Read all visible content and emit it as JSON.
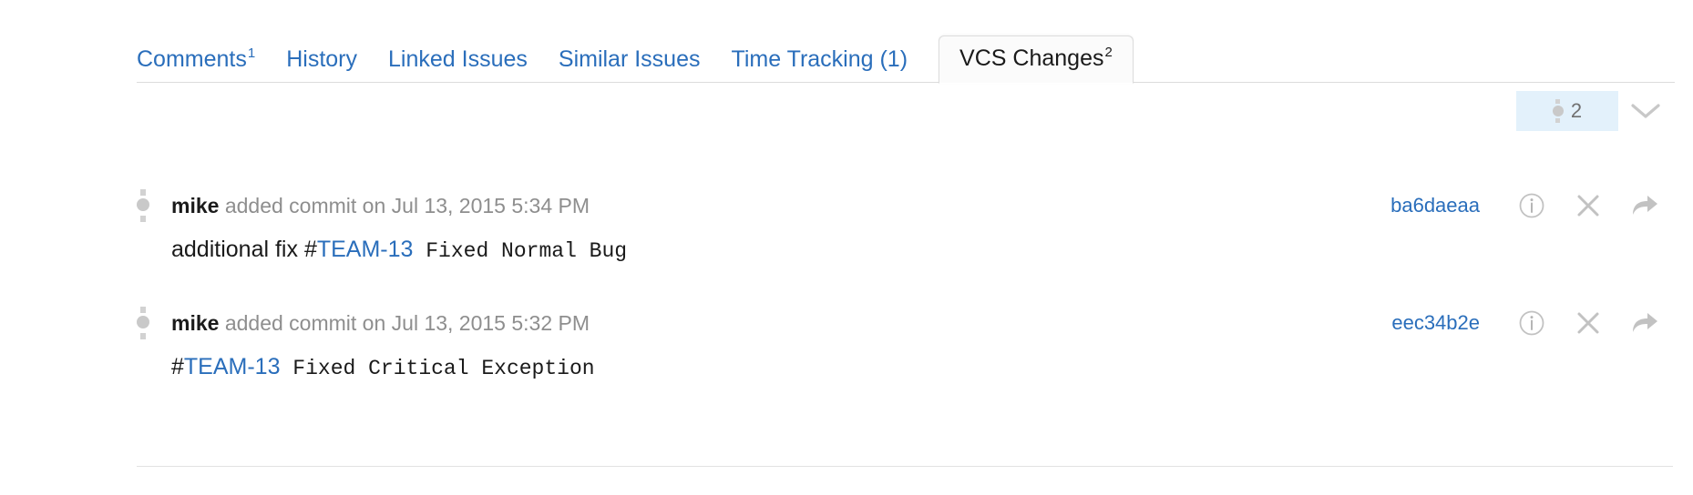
{
  "tabs": [
    {
      "label": "Comments",
      "sup": "1",
      "active": false
    },
    {
      "label": "History",
      "sup": "",
      "active": false
    },
    {
      "label": "Linked Issues",
      "sup": "",
      "active": false
    },
    {
      "label": "Similar Issues",
      "sup": "",
      "active": false
    },
    {
      "label": "Time Tracking (1)",
      "sup": "",
      "active": false
    },
    {
      "label": "VCS Changes",
      "sup": "2",
      "active": true
    }
  ],
  "toolbar": {
    "filter_icon": "commit-node-icon",
    "filter_count": "2",
    "collapse_icon": "chevron-down-icon"
  },
  "commits": [
    {
      "author": "mike",
      "action": " added commit on ",
      "timestamp": "Jul 13, 2015 5:34 PM",
      "hash": "ba6daeaa",
      "message_prefix": "additional fix ",
      "message_hash_symbol": "#",
      "message_issue": "TEAM-13",
      "message_mono": " Fixed Normal Bug",
      "icons": [
        "info-icon",
        "close-icon",
        "share-arrow-icon"
      ]
    },
    {
      "author": "mike",
      "action": " added commit on ",
      "timestamp": "Jul 13, 2015 5:32 PM",
      "hash": "eec34b2e",
      "message_prefix": "",
      "message_hash_symbol": "#",
      "message_issue": "TEAM-13",
      "message_mono": " Fixed Critical Exception",
      "icons": [
        "info-icon",
        "close-icon",
        "share-arrow-icon"
      ]
    }
  ],
  "colors": {
    "link": "#2a6ebb",
    "muted_text": "#8e8e8e",
    "badge_background": "#e3f1fb",
    "node_gray": "#c9c9c9",
    "divider": "#e2e2e2"
  }
}
